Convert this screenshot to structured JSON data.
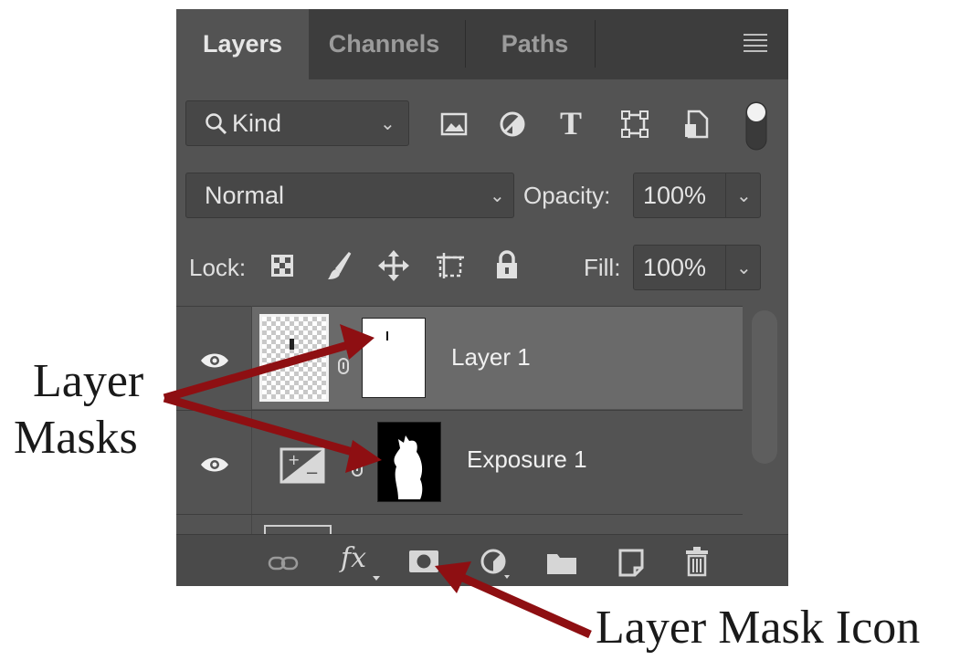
{
  "tabs": [
    {
      "label": "Layers"
    },
    {
      "label": "Channels"
    },
    {
      "label": "Paths"
    }
  ],
  "filter": {
    "label": "Kind"
  },
  "blend": {
    "mode": "Normal",
    "opacity_label": "Opacity:",
    "opacity_value": "100%"
  },
  "lock": {
    "label": "Lock:",
    "fill_label": "Fill:",
    "fill_value": "100%"
  },
  "layers": [
    {
      "name": "Layer 1",
      "selected": true
    },
    {
      "name": "Exposure 1",
      "selected": false
    }
  ],
  "annotations": {
    "layer_masks_line1": "Layer",
    "layer_masks_line2": "Masks",
    "layer_mask_icon": "Layer Mask Icon"
  },
  "colors": {
    "arrow": "#8e0f12",
    "panel": "#535353",
    "selected_row": "#6a6a6a"
  },
  "icons": [
    "search-icon",
    "image-filter-icon",
    "adjustment-filter-icon",
    "type-filter-icon",
    "shape-filter-icon",
    "smart-object-filter-icon",
    "filter-toggle-icon",
    "panel-menu-icon",
    "lock-transparent-icon",
    "lock-image-icon",
    "lock-position-icon",
    "lock-artboard-icon",
    "lock-all-icon",
    "eye-icon",
    "link-icon",
    "fx-icon",
    "layer-mask-icon",
    "adjustment-layer-icon",
    "group-folder-icon",
    "new-layer-icon",
    "trash-icon"
  ]
}
